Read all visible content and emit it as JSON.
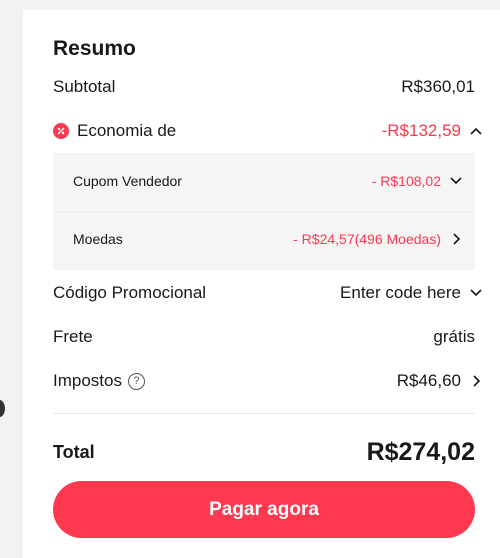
{
  "summary": {
    "title": "Resumo",
    "subtotal": {
      "label": "Subtotal",
      "value": "R$360,01"
    },
    "savings": {
      "label": "Economia de",
      "value": "-R$132,59",
      "items": [
        {
          "label": "Cupom Vendedor",
          "value": "- R$108,02"
        },
        {
          "label": "Moedas",
          "value": "- R$24,57(496 Moedas)"
        }
      ]
    },
    "promo": {
      "label": "Código Promocional",
      "placeholder": "Enter code here"
    },
    "shipping": {
      "label": "Frete",
      "value": "grátis"
    },
    "taxes": {
      "label": "Impostos",
      "help": "?",
      "value": "R$46,60"
    },
    "total": {
      "label": "Total",
      "value": "R$274,02"
    },
    "pay_button": "Pagar agora"
  },
  "colors": {
    "accent": "#fd384f",
    "text": "#191919",
    "sub_bg": "#f5f5f5"
  },
  "icons": {
    "savings_icon": "discount-icon",
    "collapse_icon": "chevron-up-icon",
    "expand_icon": "chevron-down-icon",
    "next_icon": "chevron-right-icon",
    "help_icon": "question-circle-icon"
  }
}
